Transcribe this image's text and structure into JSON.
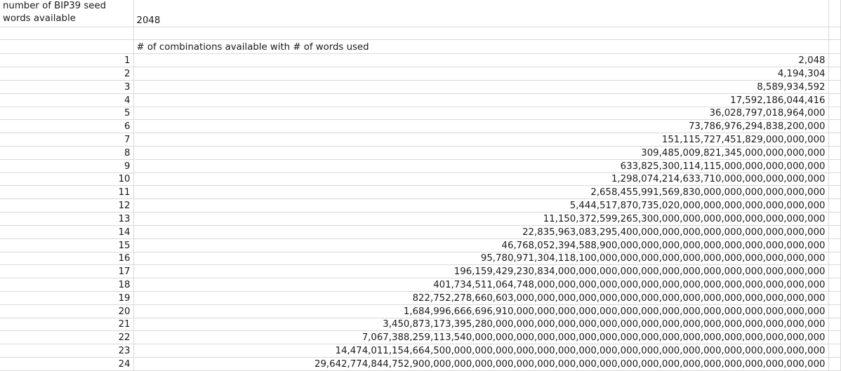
{
  "header": {
    "label": "number of BIP39 seed words available",
    "value": "2048"
  },
  "table_title": "# of combinations available with # of words used",
  "rows": [
    {
      "n": "1",
      "combos": "2,048"
    },
    {
      "n": "2",
      "combos": "4,194,304"
    },
    {
      "n": "3",
      "combos": "8,589,934,592"
    },
    {
      "n": "4",
      "combos": "17,592,186,044,416"
    },
    {
      "n": "5",
      "combos": "36,028,797,018,964,000"
    },
    {
      "n": "6",
      "combos": "73,786,976,294,838,200,000"
    },
    {
      "n": "7",
      "combos": "151,115,727,451,829,000,000,000"
    },
    {
      "n": "8",
      "combos": "309,485,009,821,345,000,000,000,000"
    },
    {
      "n": "9",
      "combos": "633,825,300,114,115,000,000,000,000,000"
    },
    {
      "n": "10",
      "combos": "1,298,074,214,633,710,000,000,000,000,000"
    },
    {
      "n": "11",
      "combos": "2,658,455,991,569,830,000,000,000,000,000,000"
    },
    {
      "n": "12",
      "combos": "5,444,517,870,735,020,000,000,000,000,000,000,000"
    },
    {
      "n": "13",
      "combos": "11,150,372,599,265,300,000,000,000,000,000,000,000,000"
    },
    {
      "n": "14",
      "combos": "22,835,963,083,295,400,000,000,000,000,000,000,000,000,000"
    },
    {
      "n": "15",
      "combos": "46,768,052,394,588,900,000,000,000,000,000,000,000,000,000,000"
    },
    {
      "n": "16",
      "combos": "95,780,971,304,118,100,000,000,000,000,000,000,000,000,000,000,000"
    },
    {
      "n": "17",
      "combos": "196,159,429,230,834,000,000,000,000,000,000,000,000,000,000,000,000,000"
    },
    {
      "n": "18",
      "combos": "401,734,511,064,748,000,000,000,000,000,000,000,000,000,000,000,000,000,000"
    },
    {
      "n": "19",
      "combos": "822,752,278,660,603,000,000,000,000,000,000,000,000,000,000,000,000,000,000,000"
    },
    {
      "n": "20",
      "combos": "1,684,996,666,696,910,000,000,000,000,000,000,000,000,000,000,000,000,000,000,000"
    },
    {
      "n": "21",
      "combos": "3,450,873,173,395,280,000,000,000,000,000,000,000,000,000,000,000,000,000,000,000,000"
    },
    {
      "n": "22",
      "combos": "7,067,388,259,113,540,000,000,000,000,000,000,000,000,000,000,000,000,000,000,000,000,000"
    },
    {
      "n": "23",
      "combos": "14,474,011,154,664,500,000,000,000,000,000,000,000,000,000,000,000,000,000,000,000,000,000,000"
    },
    {
      "n": "24",
      "combos": "29,642,774,844,752,900,000,000,000,000,000,000,000,000,000,000,000,000,000,000,000,000,000,000,000"
    }
  ]
}
